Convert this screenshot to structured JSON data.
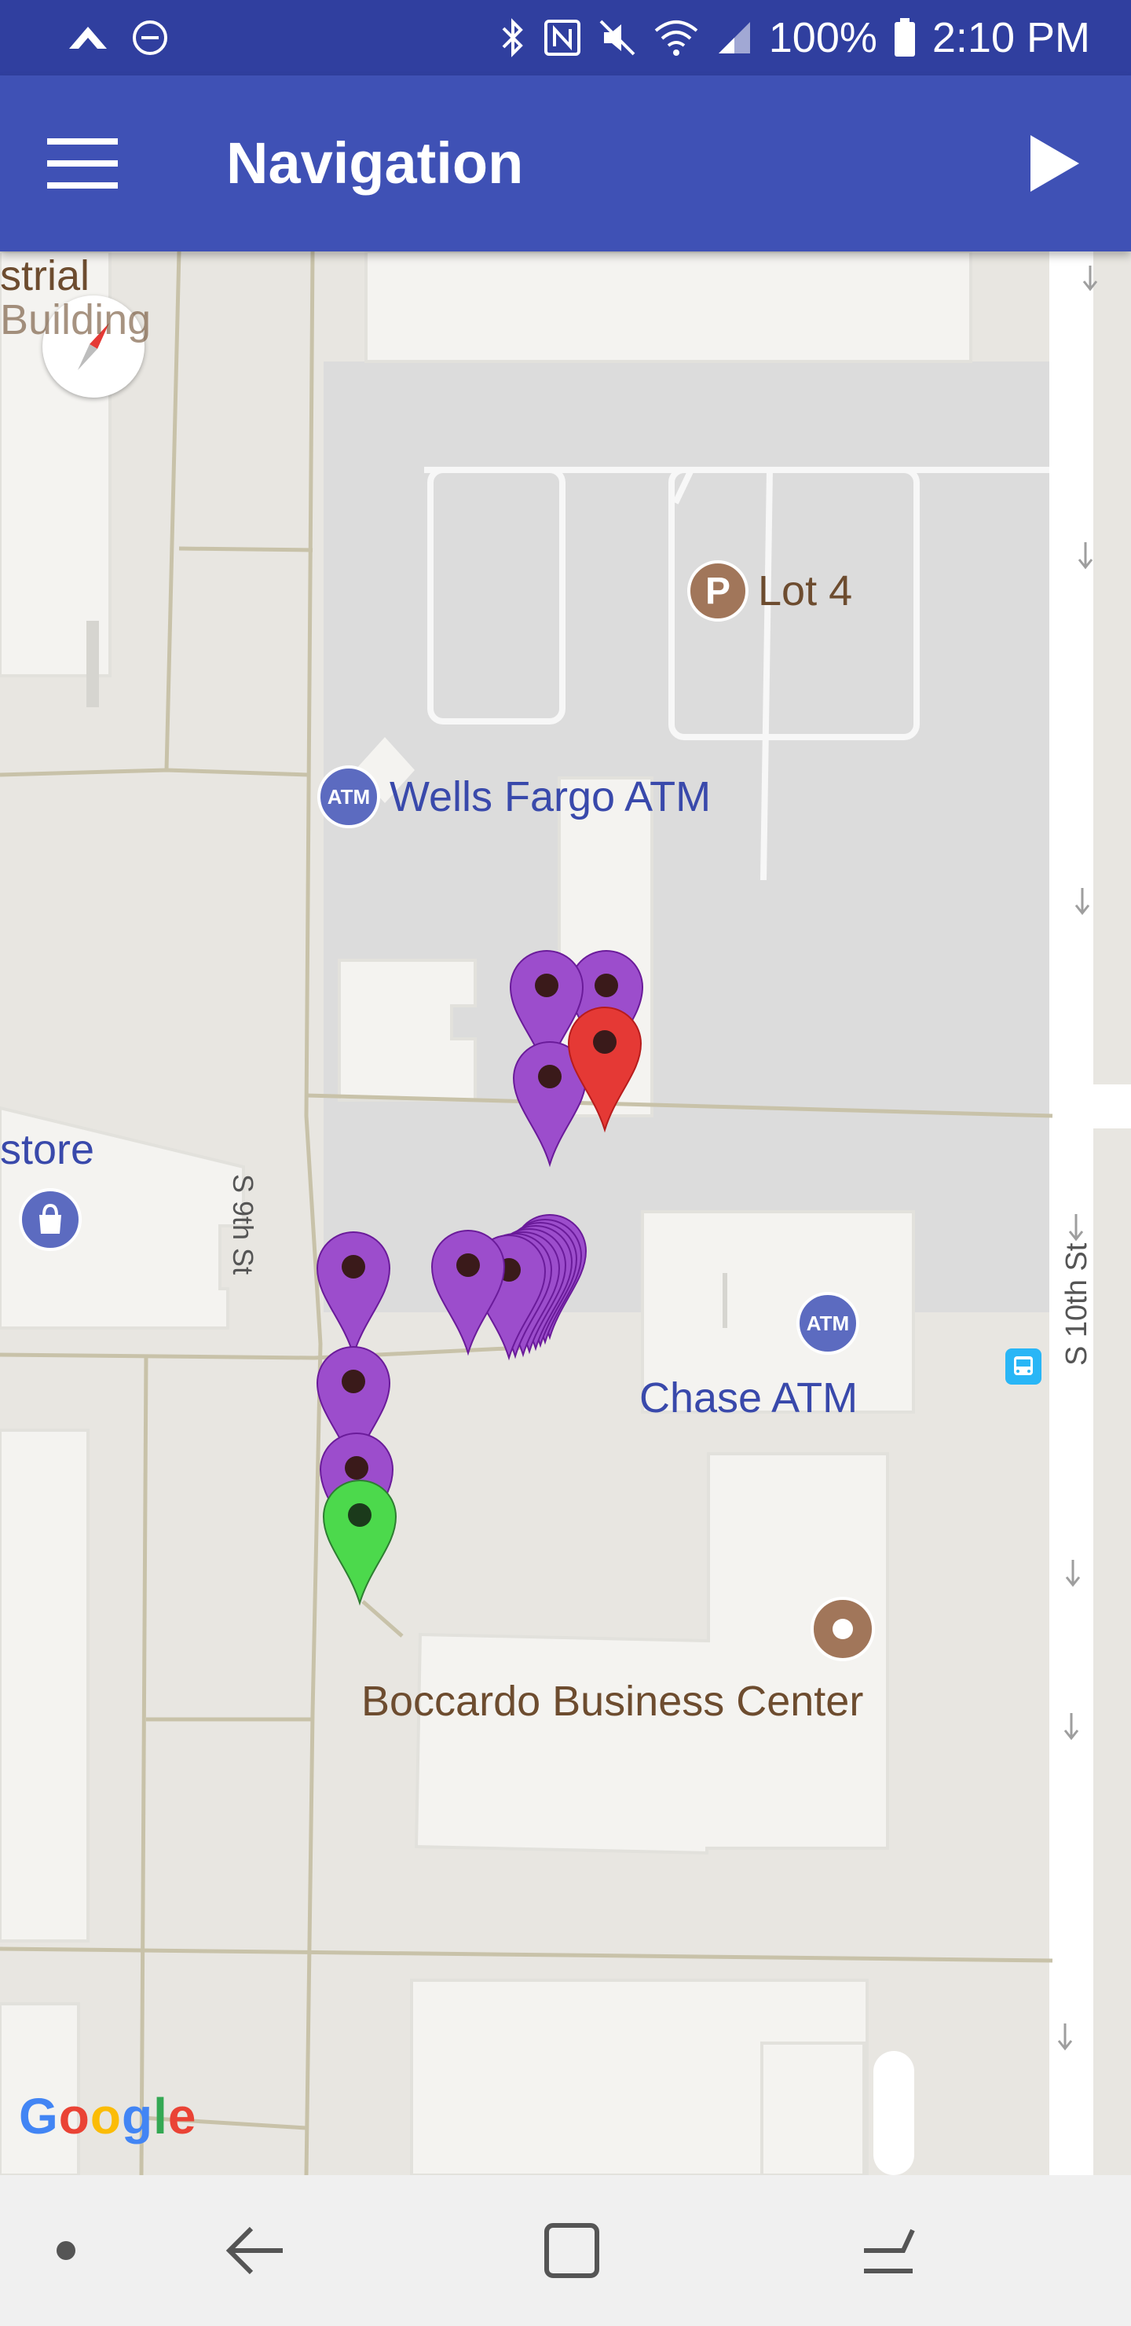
{
  "status_bar": {
    "battery": "100%",
    "time": "2:10 PM"
  },
  "app_bar": {
    "title": "Navigation"
  },
  "map": {
    "poi": {
      "lot": "Lot 4",
      "wells_atm": "Wells Fargo ATM",
      "chase_atm": "Chase ATM",
      "boccardo": "Boccardo Business Center",
      "store_fragment": "store",
      "industrial_fragment_1": "strial",
      "industrial_fragment_2": "Building"
    },
    "atm_badge": "ATM",
    "parking_badge": "P",
    "streets": {
      "s9": "S 9th St",
      "s10": "S 10th St"
    },
    "attribution": {
      "letters": [
        "G",
        "o",
        "o",
        "g",
        "l",
        "e"
      ],
      "colors": [
        "#4285f4",
        "#ea4335",
        "#fbbc05",
        "#4285f4",
        "#34a853",
        "#ea4335"
      ]
    }
  },
  "colors": {
    "status_bar": "#303f9f",
    "app_bar": "#3f51b5",
    "marker_purple": "#9c4dcc",
    "marker_red": "#e53935",
    "marker_green": "#4cd94c"
  }
}
